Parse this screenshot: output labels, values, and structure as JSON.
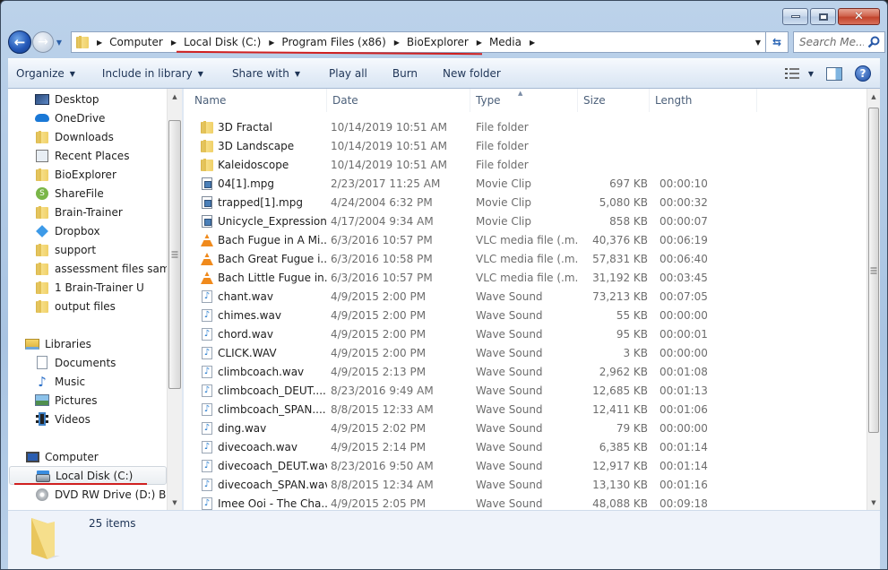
{
  "window": {
    "caption_buttons": [
      "minimize",
      "maximize",
      "close"
    ]
  },
  "address_bar": {
    "breadcrumbs": [
      "Computer",
      "Local Disk (C:)",
      "Program Files (x86)",
      "BioExplorer",
      "Media"
    ],
    "annotation_color": "#d02020"
  },
  "search": {
    "placeholder": "Search Me..."
  },
  "toolbar": {
    "organize": "Organize",
    "include_in_library": "Include in library",
    "share_with": "Share with",
    "play_all": "Play all",
    "burn": "Burn",
    "new_folder": "New folder"
  },
  "nav_pane": {
    "favorites": [
      {
        "label": "Desktop",
        "icon": "desktop-icon"
      },
      {
        "label": "OneDrive",
        "icon": "onedrive-icon"
      },
      {
        "label": "Downloads",
        "icon": "downloads-icon"
      },
      {
        "label": "Recent Places",
        "icon": "recent-places-icon"
      },
      {
        "label": "BioExplorer",
        "icon": "folder-icon"
      },
      {
        "label": "ShareFile",
        "icon": "sharefile-icon"
      },
      {
        "label": "Brain-Trainer",
        "icon": "folder-icon"
      },
      {
        "label": "Dropbox",
        "icon": "dropbox-icon"
      },
      {
        "label": "support",
        "icon": "folder-icon"
      },
      {
        "label": "assessment files sample",
        "icon": "folder-icon"
      },
      {
        "label": "1 Brain-Trainer U",
        "icon": "folder-icon"
      },
      {
        "label": "output files",
        "icon": "folder-icon"
      }
    ],
    "libraries": {
      "label": "Libraries",
      "items": [
        {
          "label": "Documents",
          "icon": "documents-icon"
        },
        {
          "label": "Music",
          "icon": "music-icon"
        },
        {
          "label": "Pictures",
          "icon": "pictures-icon"
        },
        {
          "label": "Videos",
          "icon": "videos-icon"
        }
      ]
    },
    "computer": {
      "label": "Computer",
      "items": [
        {
          "label": "Local Disk (C:)",
          "icon": "local-disk-icon",
          "selected": true
        },
        {
          "label": "DVD RW Drive (D:) BILLY",
          "icon": "dvd-drive-icon"
        }
      ]
    }
  },
  "file_list": {
    "columns": [
      "Name",
      "Date",
      "Type",
      "Size",
      "Length"
    ],
    "sorted_by": "Type",
    "rows": [
      {
        "name": "3D Fractal",
        "date": "10/14/2019 10:51 AM",
        "type": "File folder",
        "size": "",
        "length": "",
        "kind": "folder"
      },
      {
        "name": "3D Landscape",
        "date": "10/14/2019 10:51 AM",
        "type": "File folder",
        "size": "",
        "length": "",
        "kind": "folder"
      },
      {
        "name": "Kaleidoscope",
        "date": "10/14/2019 10:51 AM",
        "type": "File folder",
        "size": "",
        "length": "",
        "kind": "folder"
      },
      {
        "name": "04[1].mpg",
        "date": "2/23/2017 11:25 AM",
        "type": "Movie Clip",
        "size": "697 KB",
        "length": "00:00:10",
        "kind": "movie"
      },
      {
        "name": "trapped[1].mpg",
        "date": "4/24/2004 6:32 PM",
        "type": "Movie Clip",
        "size": "5,080 KB",
        "length": "00:00:32",
        "kind": "movie"
      },
      {
        "name": "Unicycle_Expression...",
        "date": "4/17/2004 9:34 AM",
        "type": "Movie Clip",
        "size": "858 KB",
        "length": "00:00:07",
        "kind": "movie"
      },
      {
        "name": "Bach Fugue in A Mi...",
        "date": "6/3/2016 10:57 PM",
        "type": "VLC media file (.m...",
        "size": "40,376 KB",
        "length": "00:06:19",
        "kind": "vlc"
      },
      {
        "name": "Bach Great Fugue i...",
        "date": "6/3/2016 10:58 PM",
        "type": "VLC media file (.m...",
        "size": "57,831 KB",
        "length": "00:06:40",
        "kind": "vlc"
      },
      {
        "name": "Bach Little Fugue in...",
        "date": "6/3/2016 10:57 PM",
        "type": "VLC media file (.m...",
        "size": "31,192 KB",
        "length": "00:03:45",
        "kind": "vlc"
      },
      {
        "name": "chant.wav",
        "date": "4/9/2015 2:00 PM",
        "type": "Wave Sound",
        "size": "73,213 KB",
        "length": "00:07:05",
        "kind": "wav"
      },
      {
        "name": "chimes.wav",
        "date": "4/9/2015 2:00 PM",
        "type": "Wave Sound",
        "size": "55 KB",
        "length": "00:00:00",
        "kind": "wav"
      },
      {
        "name": "chord.wav",
        "date": "4/9/2015 2:00 PM",
        "type": "Wave Sound",
        "size": "95 KB",
        "length": "00:00:01",
        "kind": "wav"
      },
      {
        "name": "CLICK.WAV",
        "date": "4/9/2015 2:00 PM",
        "type": "Wave Sound",
        "size": "3 KB",
        "length": "00:00:00",
        "kind": "wav"
      },
      {
        "name": "climbcoach.wav",
        "date": "4/9/2015 2:13 PM",
        "type": "Wave Sound",
        "size": "2,962 KB",
        "length": "00:01:08",
        "kind": "wav"
      },
      {
        "name": "climbcoach_DEUT....",
        "date": "8/23/2016 9:49 AM",
        "type": "Wave Sound",
        "size": "12,685 KB",
        "length": "00:01:13",
        "kind": "wav"
      },
      {
        "name": "climbcoach_SPAN....",
        "date": "8/8/2015 12:33 AM",
        "type": "Wave Sound",
        "size": "12,411 KB",
        "length": "00:01:06",
        "kind": "wav"
      },
      {
        "name": "ding.wav",
        "date": "4/9/2015 2:02 PM",
        "type": "Wave Sound",
        "size": "79 KB",
        "length": "00:00:00",
        "kind": "wav"
      },
      {
        "name": "divecoach.wav",
        "date": "4/9/2015 2:14 PM",
        "type": "Wave Sound",
        "size": "6,385 KB",
        "length": "00:01:14",
        "kind": "wav"
      },
      {
        "name": "divecoach_DEUT.wav",
        "date": "8/23/2016 9:50 AM",
        "type": "Wave Sound",
        "size": "12,917 KB",
        "length": "00:01:14",
        "kind": "wav"
      },
      {
        "name": "divecoach_SPAN.wav",
        "date": "8/8/2015 12:34 AM",
        "type": "Wave Sound",
        "size": "13,130 KB",
        "length": "00:01:16",
        "kind": "wav"
      },
      {
        "name": "Imee Ooi - The Cha...",
        "date": "4/9/2015 2:05 PM",
        "type": "Wave Sound",
        "size": "48,088 KB",
        "length": "00:09:18",
        "kind": "wav"
      }
    ]
  },
  "details_pane": {
    "item_count": "25 items"
  }
}
